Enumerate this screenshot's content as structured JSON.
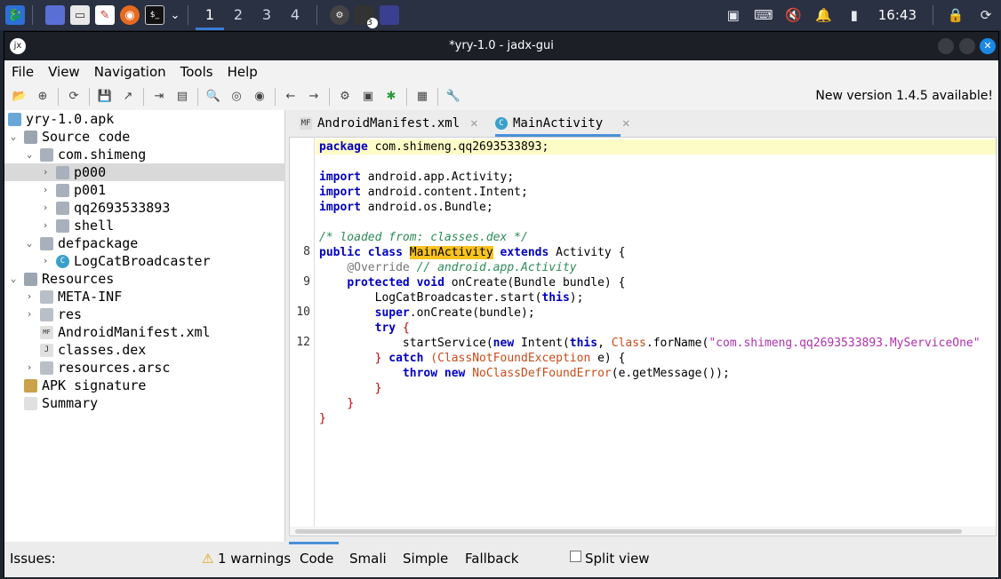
{
  "taskbar": {
    "workspaces": [
      "1",
      "2",
      "3",
      "4"
    ],
    "clock": "16:43",
    "terminal_badge": "3"
  },
  "window": {
    "title": "*yry-1.0 - jadx-gui"
  },
  "menu": [
    "File",
    "View",
    "Navigation",
    "Tools",
    "Help"
  ],
  "toolbar": {
    "update_notice": "New version 1.4.5 available!"
  },
  "tree": {
    "root": "yry-1.0.apk",
    "source_code": "Source code",
    "package": "com.shimeng",
    "sub_packages": [
      "p000",
      "p001",
      "qq2693533893",
      "shell"
    ],
    "defpackage": "defpackage",
    "class_item": "LogCatBroadcaster",
    "resources": "Resources",
    "resource_items": [
      "META-INF",
      "res",
      "AndroidManifest.xml",
      "classes.dex",
      "resources.arsc"
    ],
    "apk_signature": "APK signature",
    "summary": "Summary"
  },
  "tabs": [
    {
      "label": "AndroidManifest.xml",
      "icon": "MF"
    },
    {
      "label": "MainActivity",
      "icon": "C"
    }
  ],
  "code": {
    "line_numbers": {
      "class_decl": "8",
      "on_create": "9",
      "super_call": "10",
      "start_service": "12"
    },
    "package_kw": "package",
    "package_name": "com.shimeng.qq2693533893;",
    "imports": [
      "android.app.Activity;",
      "android.content.Intent;",
      "android.os.Bundle;"
    ],
    "import_kw": "import",
    "loaded_comment": "/* loaded from: classes.dex */",
    "class_name": "MainActivity",
    "super_class": "Activity {",
    "override_annot": "@Override",
    "override_comment": "// android.app.Activity",
    "on_create_sig": "onCreate(Bundle bundle) {",
    "logcat_call": "LogCatBroadcaster.start(",
    "super_oncreate": ".onCreate(bundle);",
    "start_service_prefix": "startService(",
    "intent_part": "Intent(",
    "forname_part": ".forName(",
    "service_string": "\"com.shimeng.qq2693533893.MyServiceOne\"",
    "catch_exc": "ClassNotFoundException",
    "catch_var": "e) {",
    "throw_exc": "NoClassDefFoundError",
    "throw_arg": "(e.getMessage());"
  },
  "bottom": {
    "issues_label": "Issues:",
    "warnings": "1 warnings",
    "view_tabs": [
      "Code",
      "Smali",
      "Simple",
      "Fallback"
    ],
    "split_view": "Split view"
  },
  "colors": {
    "accent": "#4a90d9",
    "highlight_line": "#fdfbc6",
    "keyword": "#0000c0",
    "comment": "#2e8b57",
    "search_mark": "#f8c21f"
  }
}
